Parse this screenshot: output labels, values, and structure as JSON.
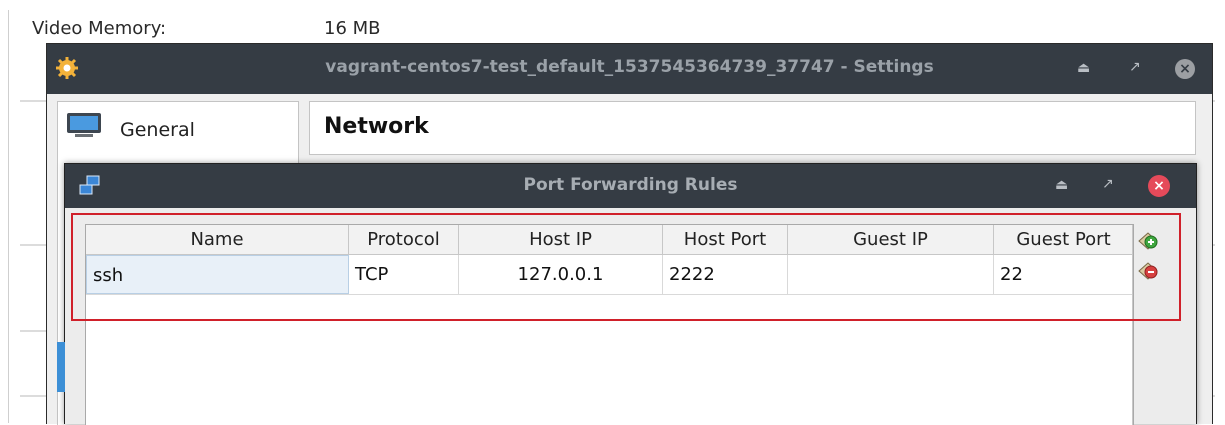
{
  "background": {
    "video_memory_label": "Video Memory:",
    "video_memory_value": "16 MB"
  },
  "settings_window": {
    "title": "vagrant-centos7-test_default_1537545364739_37747 - Settings",
    "sidebar": {
      "items": [
        {
          "label": "General",
          "icon": "monitor-icon"
        }
      ]
    },
    "section_title": "Network"
  },
  "port_forwarding": {
    "title": "Port Forwarding Rules",
    "columns": [
      "Name",
      "Protocol",
      "Host IP",
      "Host Port",
      "Guest IP",
      "Guest Port"
    ],
    "rows": [
      {
        "name": "ssh",
        "protocol": "TCP",
        "host_ip": "127.0.0.1",
        "host_port": "2222",
        "guest_ip": "",
        "guest_port": "22"
      }
    ],
    "actions": {
      "add": "add-rule-icon",
      "remove": "remove-rule-icon"
    }
  },
  "colors": {
    "titlebar": "#353c44",
    "highlight_frame": "#d0202a",
    "close_button": "#e54a5a"
  }
}
